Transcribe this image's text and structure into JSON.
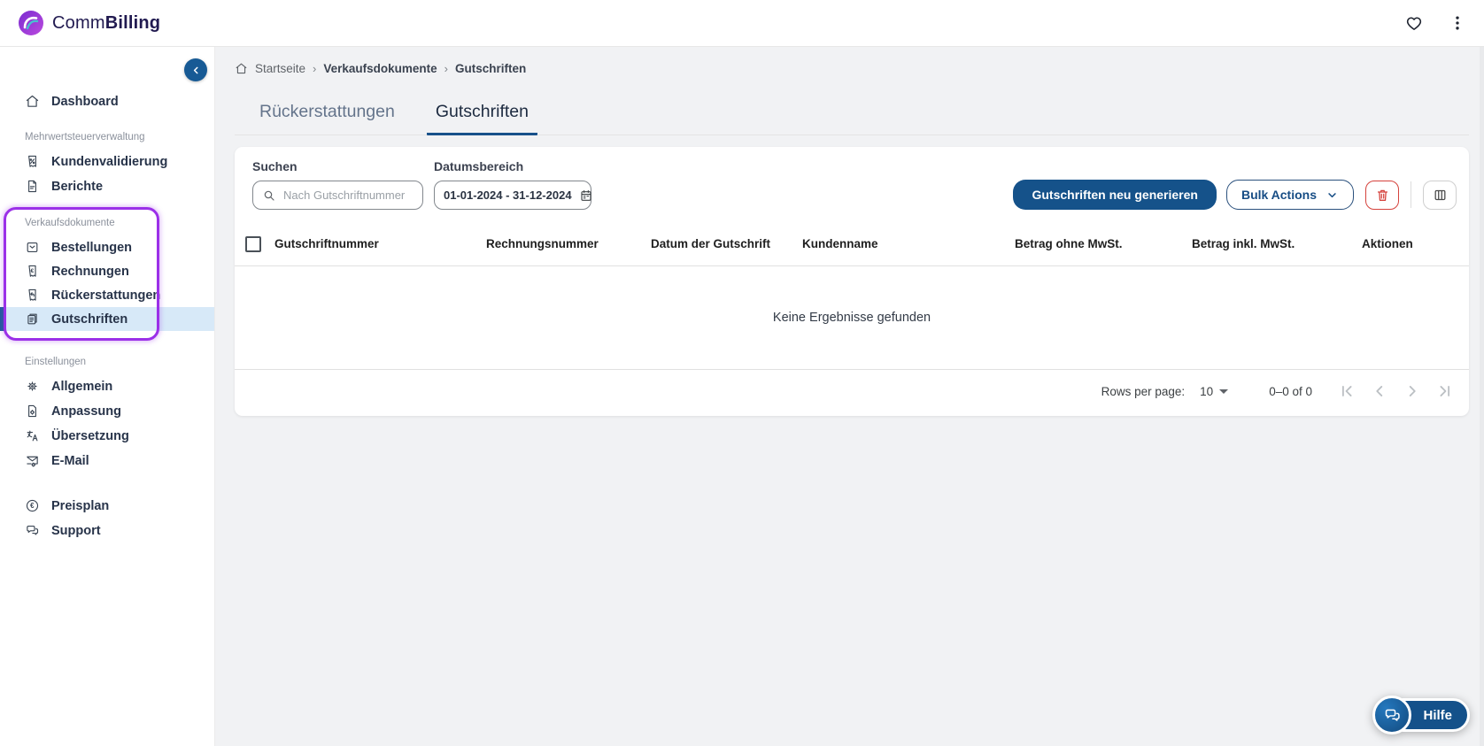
{
  "brand": {
    "regular": "Comm",
    "bold": "Billing"
  },
  "sidebar": {
    "groups": [
      {
        "title": "",
        "items": [
          {
            "label": "Dashboard",
            "icon": "home-icon",
            "active": false
          }
        ]
      },
      {
        "title": "Mehrwertsteuerverwaltung",
        "items": [
          {
            "label": "Kundenvalidierung",
            "icon": "receipt-percent-icon",
            "active": false
          },
          {
            "label": "Berichte",
            "icon": "report-document-icon",
            "active": false
          }
        ]
      },
      {
        "title": "Verkaufsdokumente",
        "highlighted": true,
        "items": [
          {
            "label": "Bestellungen",
            "icon": "order-inbox-icon",
            "active": false
          },
          {
            "label": "Rechnungen",
            "icon": "invoice-receipt-icon",
            "active": false
          },
          {
            "label": "Rückerstattungen",
            "icon": "refund-receipt-icon",
            "active": false
          },
          {
            "label": "Gutschriften",
            "icon": "credit-note-icon",
            "active": true
          }
        ]
      },
      {
        "title": "Einstellungen",
        "items": [
          {
            "label": "Allgemein",
            "icon": "gear-icon",
            "active": false
          },
          {
            "label": "Anpassung",
            "icon": "document-gear-icon",
            "active": false
          },
          {
            "label": "Übersetzung",
            "icon": "translate-icon",
            "active": false
          },
          {
            "label": "E-Mail",
            "icon": "mail-gear-icon",
            "active": false
          }
        ]
      },
      {
        "title": "",
        "items": [
          {
            "label": "Preisplan",
            "icon": "euro-circle-icon",
            "active": false
          },
          {
            "label": "Support",
            "icon": "support-chat-icon",
            "active": false
          }
        ]
      }
    ]
  },
  "breadcrumb": {
    "items": [
      "Startseite",
      "Verkaufsdokumente",
      "Gutschriften"
    ],
    "separator": "›"
  },
  "tabs": [
    {
      "label": "Rückerstattungen",
      "active": false
    },
    {
      "label": "Gutschriften",
      "active": true
    }
  ],
  "filters": {
    "search_label": "Suchen",
    "search_placeholder": "Nach Gutschriftnummer",
    "search_value": "",
    "date_label": "Datumsbereich",
    "date_value": "01-01-2024 - 31-12-2024"
  },
  "toolbar": {
    "generate_button": "Gutschriften neu generieren",
    "bulk_button": "Bulk Actions",
    "delete_icon": "trash-icon",
    "columns_icon": "columns-icon"
  },
  "table": {
    "headers": [
      "Gutschriftnummer",
      "Rechnungsnummer",
      "Datum der Gutschrift",
      "Kundenname",
      "Betrag ohne MwSt.",
      "Betrag inkl. MwSt.",
      "Aktionen"
    ],
    "empty_text": "Keine Ergebnisse gefunden",
    "rows": []
  },
  "pagination": {
    "rows_per_page_label": "Rows per page:",
    "rows_per_page_value": "10",
    "range": "0–0 of 0"
  },
  "help": {
    "label": "Hilfe"
  },
  "colors": {
    "primary": "#15528a",
    "accent_purple": "#9b30e8",
    "active_nav_bg": "#d7e9f8",
    "tab_underline": "#17518a",
    "danger": "#d5423c"
  }
}
